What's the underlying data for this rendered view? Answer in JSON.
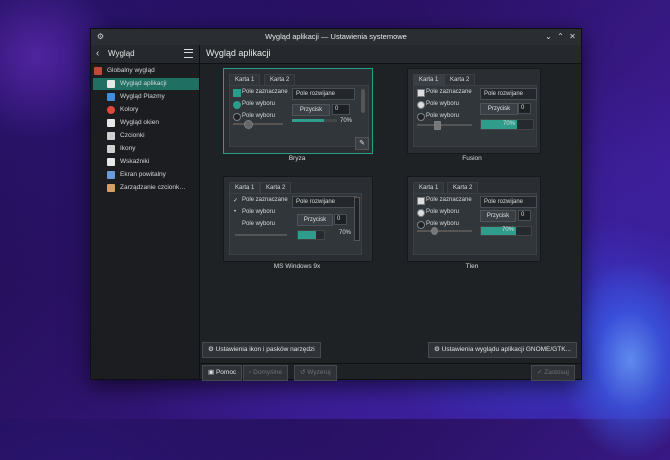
{
  "window": {
    "title": "Wygląd aplikacji — Ustawienia systemowe"
  },
  "sidebar": {
    "header": "Wygląd",
    "items": [
      {
        "label": "Globalny wygląd",
        "icon": "global-theme-icon",
        "color": "#c04a3a"
      },
      {
        "label": "Wygląd aplikacji",
        "icon": "app-style-icon",
        "color": "#e8e8e8",
        "selected": true
      },
      {
        "label": "Wygląd Plazmy",
        "icon": "plasma-style-icon",
        "color": "#3f8fdc"
      },
      {
        "label": "Kolory",
        "icon": "colors-icon",
        "color": "#e0483a"
      },
      {
        "label": "Wygląd okien",
        "icon": "window-decoration-icon",
        "color": "#e8e8e8"
      },
      {
        "label": "Czcionki",
        "icon": "fonts-icon",
        "color": "#d0d0d0"
      },
      {
        "label": "Ikony",
        "icon": "icons-icon",
        "color": "#d0d0d0"
      },
      {
        "label": "Wskaźniki",
        "icon": "cursors-icon",
        "color": "#e8e8e8"
      },
      {
        "label": "Ekran powitalny",
        "icon": "splash-icon",
        "color": "#6a9ad8"
      },
      {
        "label": "Zarządzanie czcionk…",
        "icon": "font-management-icon",
        "color": "#d8a060"
      }
    ]
  },
  "main": {
    "title": "Wygląd aplikacji",
    "styles": [
      {
        "name": "Bryza",
        "tab1": "Karta 1",
        "tab2": "Karta 2",
        "checkbox": "Pole zaznaczane",
        "radio1": "Pole wyboru",
        "radio2": "Pole wyboru",
        "combo": "Pole rozwijane",
        "button": "Przycisk",
        "spin": "0",
        "progress": 0.7,
        "progress_label": "70%"
      },
      {
        "name": "Fusion",
        "tab1": "Karta 1",
        "tab2": "Karta 2",
        "checkbox": "Pole zaznaczane",
        "radio1": "Pole wyboru",
        "radio2": "Pole wyboru",
        "combo": "Pole rozwijane",
        "button": "Przycisk",
        "spin": "0",
        "progress": 0.7,
        "progress_label": "70%"
      },
      {
        "name": "MS Windows 9x",
        "tab1": "Karta 1",
        "tab2": "Karta 2",
        "checkbox": "Pole zaznaczane",
        "radio1": "Pole wyboru",
        "radio2": "Pole wyboru",
        "combo": "Pole rozwijane",
        "button": "Przycisk",
        "spin": "0",
        "progress": 0.7,
        "progress_label": "70%"
      },
      {
        "name": "Tlen",
        "tab1": "Karta 1",
        "tab2": "Karta 2",
        "checkbox": "Pole zaznaczane",
        "radio1": "Pole wyboru",
        "radio2": "Pole wyboru",
        "combo": "Pole rozwijane",
        "button": "Przycisk",
        "spin": "0",
        "progress": 0.7,
        "progress_label": "70%"
      }
    ],
    "toolbar_buttons": {
      "icons_settings": "Ustawienia ikon i pasków narzędzi",
      "gtk_settings": "Ustawienia wyglądu aplikacji GNOME/GTK..."
    },
    "footer": {
      "help": "Pomoc",
      "defaults": "Domyślne",
      "reset": "Wyzeruj",
      "apply": "Zastosuj"
    }
  },
  "colors": {
    "accent": "#2a9c8a",
    "selection": "#1f6f63",
    "background": "#1f2225"
  }
}
